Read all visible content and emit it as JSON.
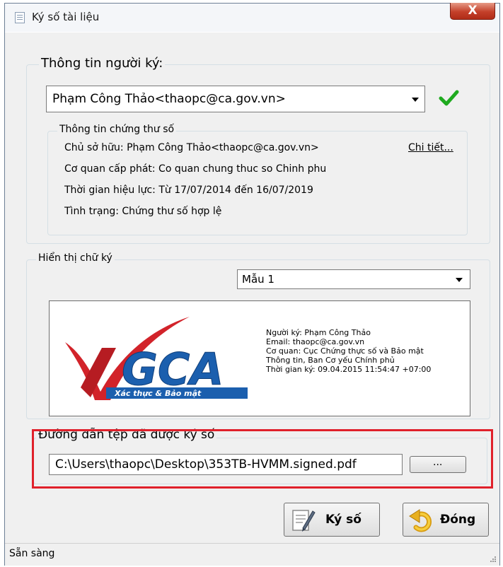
{
  "window": {
    "title": "Ký số tài liệu",
    "close_glyph": "X"
  },
  "signer_group": {
    "title": "Thông tin người ký:",
    "selected_signer": "Phạm Công Thảo<thaopc@ca.gov.vn>",
    "status_icon": "green-check-icon",
    "certificate": {
      "title": "Thông tin chứng thư số",
      "owner": "Chủ sở hữu: Phạm Công Thảo<thaopc@ca.gov.vn>",
      "details_link": "Chi tiết...",
      "issuer": "Cơ quan cấp phát: Co quan chung thuc so Chinh phu",
      "validity": "Thời gian hiệu lực: Từ 17/07/2014 đến 16/07/2019",
      "status": "Tình trạng: Chứng thư số hợp lệ"
    }
  },
  "signature_group": {
    "title": "Hiển thị chữ ký",
    "template_selected": "Mẫu 1",
    "logo": {
      "text": "GCA",
      "tagline": "Xác thực & Bảo mật"
    },
    "preview_lines": [
      "Người ký: Phạm Công Thảo",
      "Email: thaopc@ca.gov.vn",
      "Cơ quan: Cục Chứng thực số và Bảo mật",
      "Thông tin, Ban Cơ yếu Chính phủ",
      "Thời gian ký: 09.04.2015 11:54:47 +07:00"
    ]
  },
  "output_group": {
    "title": "Đường dẫn tệp đã được ký số",
    "path_value": "C:\\Users\\thaopc\\Desktop\\353TB-HVMM.signed.pdf",
    "browse_label": "..."
  },
  "buttons": {
    "sign_label": "Ký số",
    "close_label": "Đóng"
  },
  "status_bar": {
    "text": "Sẵn sàng"
  },
  "colors": {
    "highlight_border": "#e0212b",
    "check_green": "#1faa1f",
    "logo_red": "#d2232a",
    "logo_blue": "#1b5fae"
  }
}
